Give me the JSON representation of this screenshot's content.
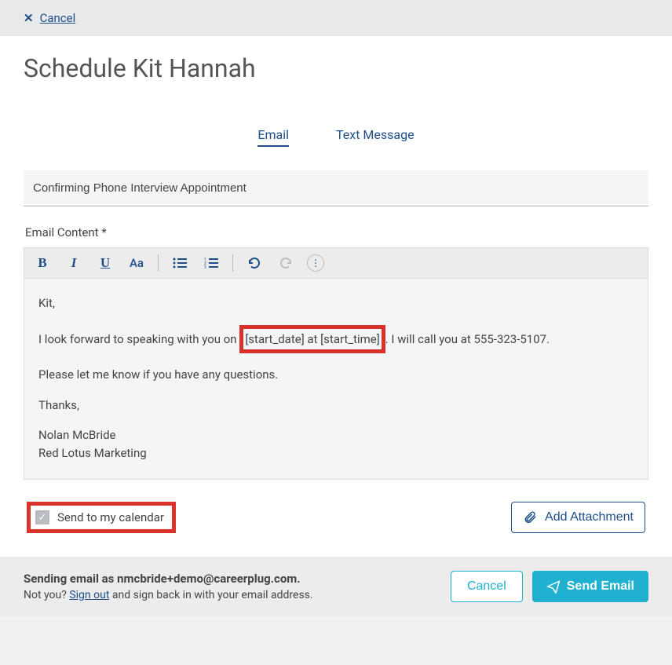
{
  "topbar": {
    "cancel": "Cancel"
  },
  "title": "Schedule Kit Hannah",
  "tabs": {
    "email": "Email",
    "text": "Text Message"
  },
  "subject": "Confirming Phone Interview Appointment",
  "labels": {
    "emailContent": "Email Content *"
  },
  "email": {
    "greeting": "Kit,",
    "line1_pre": "I look forward to speaking with you on ",
    "line1_highlight": "[start_date] at [start_time]",
    "line1_post": ". I will call you at 555-323-5107.",
    "line2": "Please let me know if you have any questions.",
    "thanks": "Thanks,",
    "sig1": "Nolan McBride",
    "sig2": "Red Lotus Marketing"
  },
  "checkbox": {
    "label": "Send to my calendar"
  },
  "buttons": {
    "attach": "Add Attachment",
    "cancel": "Cancel",
    "send": "Send Email"
  },
  "footer": {
    "sending": "Sending email as nmcbride+demo@careerplug.com.",
    "notyou": "Not you? ",
    "signout": "Sign out",
    "rest": " and sign back in with your email address."
  },
  "toolbar": {
    "aa": "Aa"
  }
}
